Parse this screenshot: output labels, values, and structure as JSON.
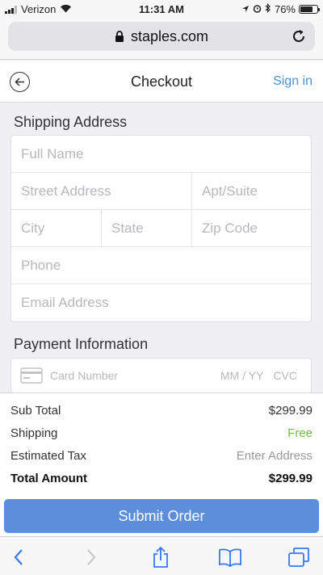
{
  "status_bar": {
    "carrier": "Verizon",
    "time": "11:31 AM",
    "battery_percent": "76%",
    "battery_level": 0.76,
    "icons": [
      "signal-icon",
      "wifi-icon",
      "location-icon",
      "alarm-icon",
      "bluetooth-icon",
      "battery-icon"
    ]
  },
  "browser": {
    "url": "staples.com",
    "icons": [
      "lock-icon",
      "reload-icon"
    ]
  },
  "header": {
    "title": "Checkout",
    "signin_label": "Sign in",
    "back_icon": "back-arrow-circle-icon"
  },
  "shipping": {
    "title": "Shipping Address",
    "placeholders": {
      "full_name": "Full Name",
      "street": "Street Address",
      "apt": "Apt/Suite",
      "city": "City",
      "state": "State",
      "zip": "Zip Code",
      "phone": "Phone",
      "email": "Email Address"
    }
  },
  "payment": {
    "title": "Payment Information",
    "card_number": "Card Number",
    "expiry": "MM / YY",
    "cvc": "CVC",
    "card_icon": "credit-card-icon"
  },
  "summary": {
    "subtotal_label": "Sub Total",
    "subtotal_value": "$299.99",
    "shipping_label": "Shipping",
    "shipping_value": "Free",
    "tax_label": "Estimated Tax",
    "tax_value": "Enter Address",
    "total_label": "Total Amount",
    "total_value": "$299.99"
  },
  "submit_label": "Submit Order",
  "colors": {
    "accent": "#4a90d9",
    "submit": "#5b8fdc",
    "free": "#6cbf45",
    "toolbar_icon": "#3478f6"
  },
  "toolbar": {
    "icons": [
      "back-chevron-icon",
      "forward-chevron-icon",
      "share-icon",
      "bookmarks-icon",
      "tabs-icon"
    ]
  }
}
